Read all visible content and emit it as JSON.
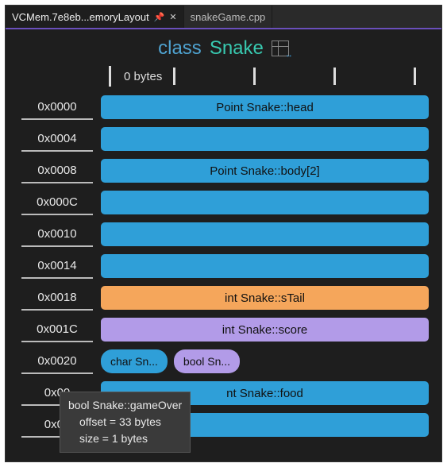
{
  "tabs": {
    "active": {
      "label": "VCMem.7e8eb...emoryLayout"
    },
    "inactive": {
      "label": "snakeGame.cpp"
    }
  },
  "title": {
    "keyword": "class",
    "name": "Snake"
  },
  "ruler": {
    "label": "0 bytes"
  },
  "rows": [
    {
      "addr": "0x0000",
      "type": "bar",
      "color": "blue",
      "label": "Point Snake::head"
    },
    {
      "addr": "0x0004",
      "type": "bar",
      "color": "blue",
      "label": ""
    },
    {
      "addr": "0x0008",
      "type": "bar",
      "color": "blue",
      "label": "Point Snake::body[2]"
    },
    {
      "addr": "0x000C",
      "type": "bar",
      "color": "blue",
      "label": ""
    },
    {
      "addr": "0x0010",
      "type": "bar",
      "color": "blue",
      "label": ""
    },
    {
      "addr": "0x0014",
      "type": "bar",
      "color": "blue",
      "label": ""
    },
    {
      "addr": "0x0018",
      "type": "bar",
      "color": "orange",
      "label": "int Snake::sTail"
    },
    {
      "addr": "0x001C",
      "type": "bar",
      "color": "purple",
      "label": "int Snake::score"
    },
    {
      "addr": "0x0020",
      "type": "pair",
      "left": {
        "color": "blue",
        "label": "char Sn..."
      },
      "right": {
        "color": "purple",
        "label": "bool Sn..."
      }
    },
    {
      "addr": "0x00",
      "type": "bar",
      "color": "blue",
      "label": "nt Snake::food"
    },
    {
      "addr": "0x00",
      "type": "bar",
      "color": "blue",
      "label": ""
    }
  ],
  "tooltip": {
    "line1": "bool Snake::gameOver",
    "line2": "offset = 33 bytes",
    "line3": "size = 1 bytes"
  }
}
